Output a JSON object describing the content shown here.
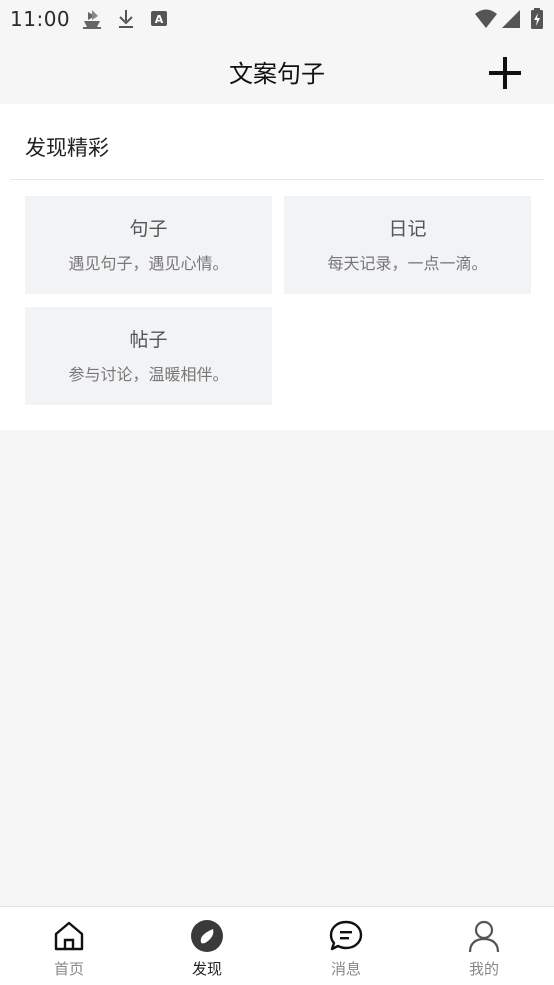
{
  "status_bar": {
    "time": "11:00",
    "icons": [
      "ship-icon",
      "download-icon",
      "font-a-icon",
      "wifi-icon",
      "signal-icon",
      "battery-icon"
    ]
  },
  "header": {
    "title": "文案句子",
    "add_icon": "plus-icon"
  },
  "discover": {
    "section_title": "发现精彩",
    "cards": [
      {
        "title": "句子",
        "subtitle": "遇见句子，遇见心情。"
      },
      {
        "title": "日记",
        "subtitle": "每天记录，一点一滴。"
      },
      {
        "title": "帖子",
        "subtitle": "参与讨论，温暖相伴。"
      }
    ]
  },
  "bottom_nav": {
    "active_index": 1,
    "items": [
      {
        "label": "首页",
        "icon": "home-icon"
      },
      {
        "label": "发现",
        "icon": "compass-icon"
      },
      {
        "label": "消息",
        "icon": "message-icon"
      },
      {
        "label": "我的",
        "icon": "user-icon"
      }
    ]
  },
  "colors": {
    "background": "#f6f6f6",
    "card_background": "#f2f3f5",
    "active_nav": "#222222",
    "inactive_nav": "#888888"
  }
}
